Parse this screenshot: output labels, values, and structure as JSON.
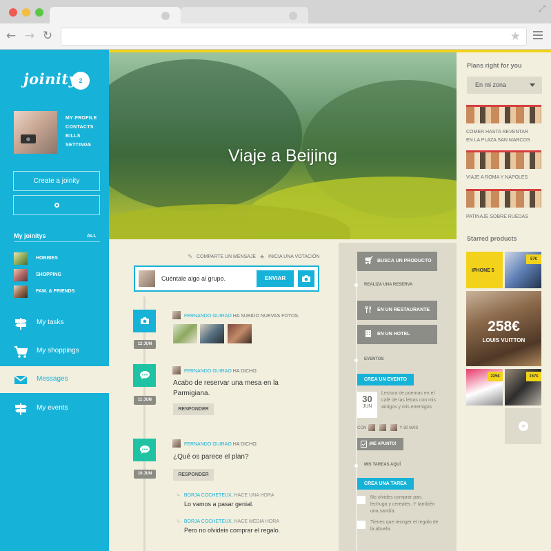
{
  "browser": {
    "nav_back": "←",
    "nav_forward": "→",
    "nav_reload": "↻",
    "star": "★",
    "resize": "⤢"
  },
  "sidebar": {
    "logo": "joinity",
    "badge_count": "2",
    "profile_links": [
      "MY PROFILE",
      "CONTACTS",
      "BILLS",
      "SETTINGS"
    ],
    "create_button": "Create a joinity",
    "my_joinitys_title": "My joinitys",
    "all_link": "ALL",
    "joinitys": [
      {
        "label": "HOBBIES"
      },
      {
        "label": "SHOPPING"
      },
      {
        "label": "FAM. & FRIENDS"
      }
    ],
    "nav": [
      {
        "label": "My tasks",
        "icon": "signpost-icon"
      },
      {
        "label": "My shoppings",
        "icon": "cart-icon"
      },
      {
        "label": "Messages",
        "icon": "envelope-icon"
      },
      {
        "label": "My events",
        "icon": "signpost-icon"
      }
    ]
  },
  "hero": {
    "title": "Viaje a Beijing"
  },
  "composer": {
    "share_message": "COMPARTE UN MENSAJE",
    "start_vote": "INICIA UNA VOTACIÓN",
    "placeholder": "Cuéntale algo al grupo.",
    "send": "ENVIAR"
  },
  "feed": [
    {
      "date": "12 JUN",
      "author": "FERNANDO GUIRAO",
      "action": "HA SUBIDO NUEVAS FOTOS.",
      "icon": "camera-icon"
    },
    {
      "date": "11 JUN",
      "author": "FERNANDO GUIRAO",
      "action": "HA DICHO:",
      "message_line1": "Acabo de reservar una mesa en la",
      "message_line2": "Parmigiana.",
      "reply": "RESPONDER",
      "icon": "chat-icon"
    },
    {
      "date": "10 JUN",
      "author": "FERNANDO GUIRAO",
      "action": "HA DICHO:",
      "message": "¿Qué os parece el plan?",
      "reply": "RESPONDER",
      "icon": "chat-icon",
      "comments": [
        {
          "author": "BORJA COCHETEUX",
          "time": "HACE UNA HORA",
          "text": "Lo vamos a pasar genial."
        },
        {
          "author": "BORJA COCHETEUX",
          "time": "HACE MEDIA HORA",
          "text": "Pero no olvideis comprar el regalo."
        }
      ]
    }
  ],
  "panel": {
    "find_product": "BUSCA UN PRODUCTO",
    "reserve_label": "REALIZA UNA RESERVA",
    "restaurant": "EN UN RESTAURANTE",
    "hotel": "EN UN HOTEL",
    "events_label": "EVENTOS",
    "create_event": "CREA UN EVENTO",
    "event_day": "30",
    "event_month": "JUN",
    "event_desc": "Lectura de poemas en el café de las letras con mis amigos y mis enemigos",
    "con": "CON",
    "more": "Y 30 MÁS",
    "join": "¡ME APUNTO!",
    "tasks_label": "MIS TAREAS AQUÍ",
    "create_task": "CREA UNA TAREA",
    "tasks": [
      "No olvides comprar pan, lechuga y cereales. Y también una sandía.",
      "Tienes que recoger el regalo de la abuela."
    ]
  },
  "right": {
    "plans_title": "Plans right for you",
    "select_value": "En mi zona",
    "plans": [
      {
        "line1": "COMER HASTA REVENTAR",
        "line2": "EN LA PLAZA SAN MARCOS"
      },
      {
        "line1": "VIAJE A ROMA Y NÁPOLES",
        "line2": ""
      },
      {
        "line1": "PATINAJE SOBRE RUEDAS",
        "line2": ""
      }
    ],
    "starred_title": "Starred products",
    "products": {
      "iphone_label": "IPHONE 5",
      "iphone_price": "57€",
      "bag_price": "258€",
      "bag_brand": "LOUIS VUITTON",
      "shoe_price": "225€",
      "phone_price": "157€",
      "add": "+"
    }
  }
}
